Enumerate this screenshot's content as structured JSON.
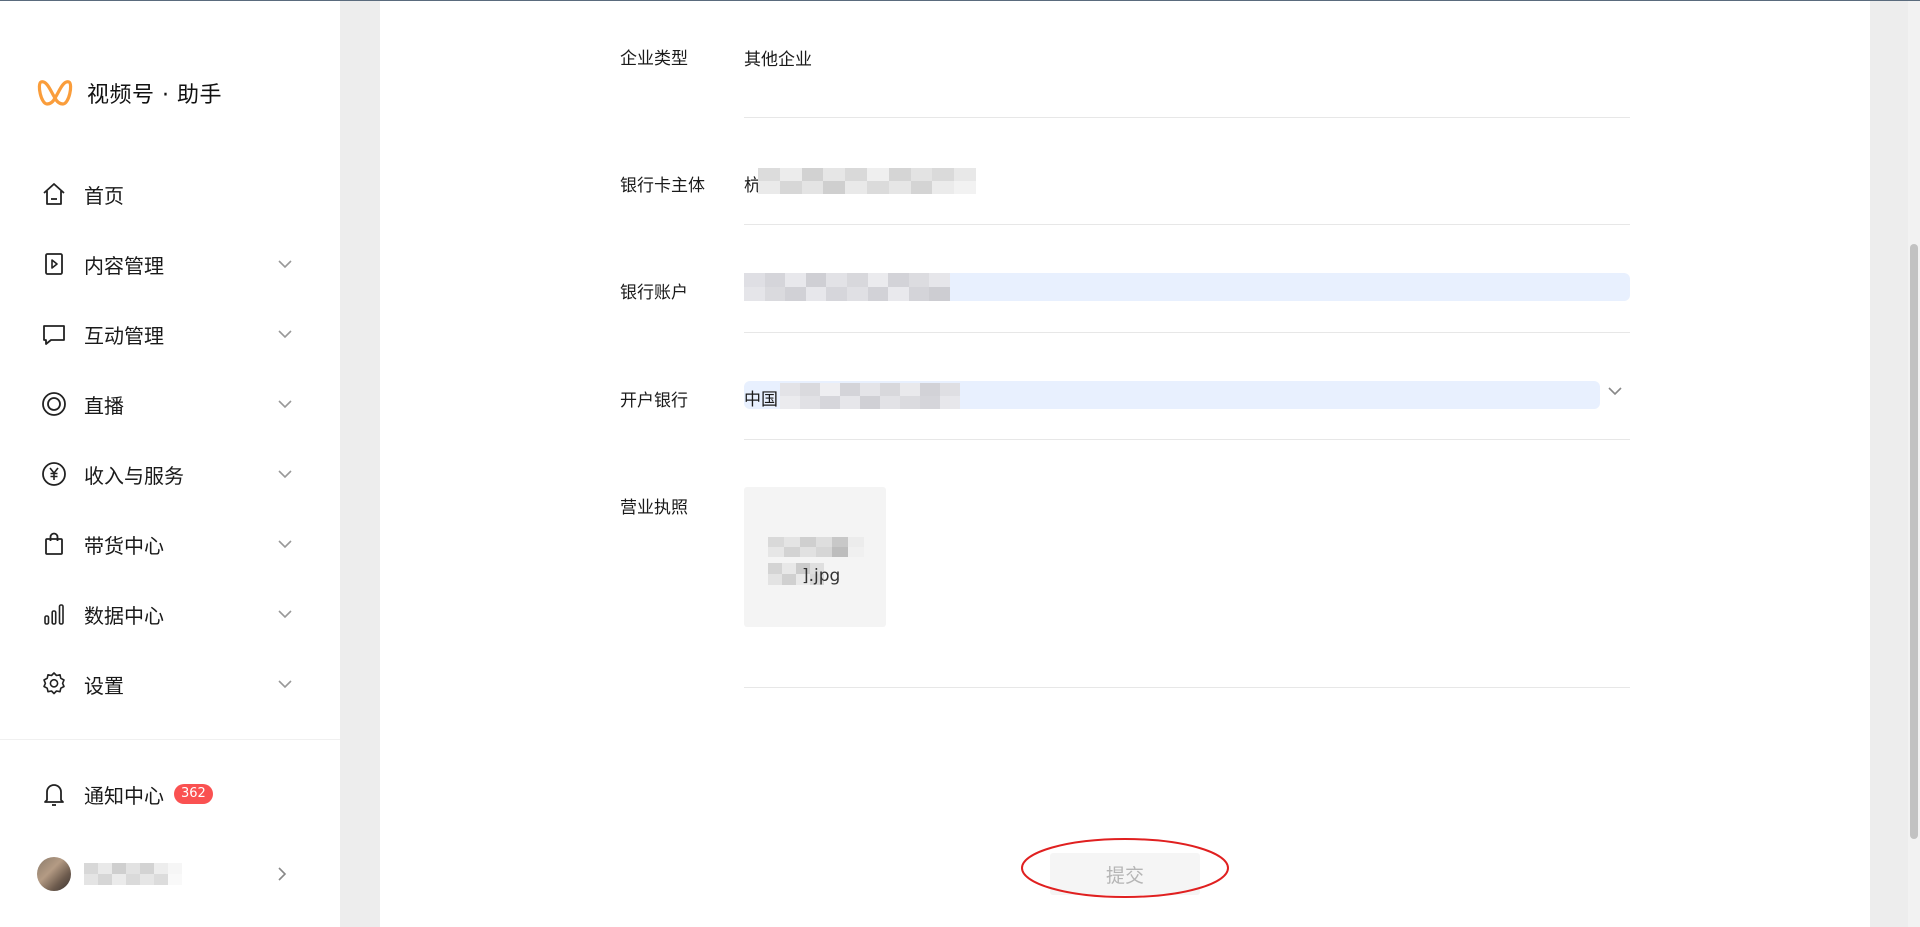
{
  "app": {
    "brand_name": "视频号 · 助手",
    "accent_color": "#fa9d3b"
  },
  "sidebar": {
    "items": [
      {
        "label": "首页",
        "icon": "home-icon",
        "expandable": false
      },
      {
        "label": "内容管理",
        "icon": "video-file-icon",
        "expandable": true
      },
      {
        "label": "互动管理",
        "icon": "comment-icon",
        "expandable": true
      },
      {
        "label": "直播",
        "icon": "live-icon",
        "expandable": true
      },
      {
        "label": "收入与服务",
        "icon": "yuan-icon",
        "expandable": true
      },
      {
        "label": "带货中心",
        "icon": "shopping-bag-icon",
        "expandable": true
      },
      {
        "label": "数据中心",
        "icon": "bar-chart-icon",
        "expandable": true
      },
      {
        "label": "设置",
        "icon": "gear-icon",
        "expandable": true
      }
    ],
    "notice": {
      "label": "通知中心",
      "badge": "362",
      "icon": "bell-icon",
      "badge_color": "#fa5151"
    },
    "account": {
      "icon": "chevron-right-icon"
    }
  },
  "form": {
    "enterprise_type": {
      "label": "企业类型",
      "value": "其他企业"
    },
    "card_holder": {
      "label": "银行卡主体",
      "value_prefix": "杭"
    },
    "bank_account": {
      "label": "银行账户"
    },
    "bank_name": {
      "label": "开户银行",
      "value_prefix": "中国",
      "icon": "chevron-down-icon"
    },
    "business_license": {
      "label": "营业执照",
      "file_suffix": "].jpg"
    }
  },
  "actions": {
    "submit_label": "提交",
    "highlight_color": "#e02020"
  }
}
